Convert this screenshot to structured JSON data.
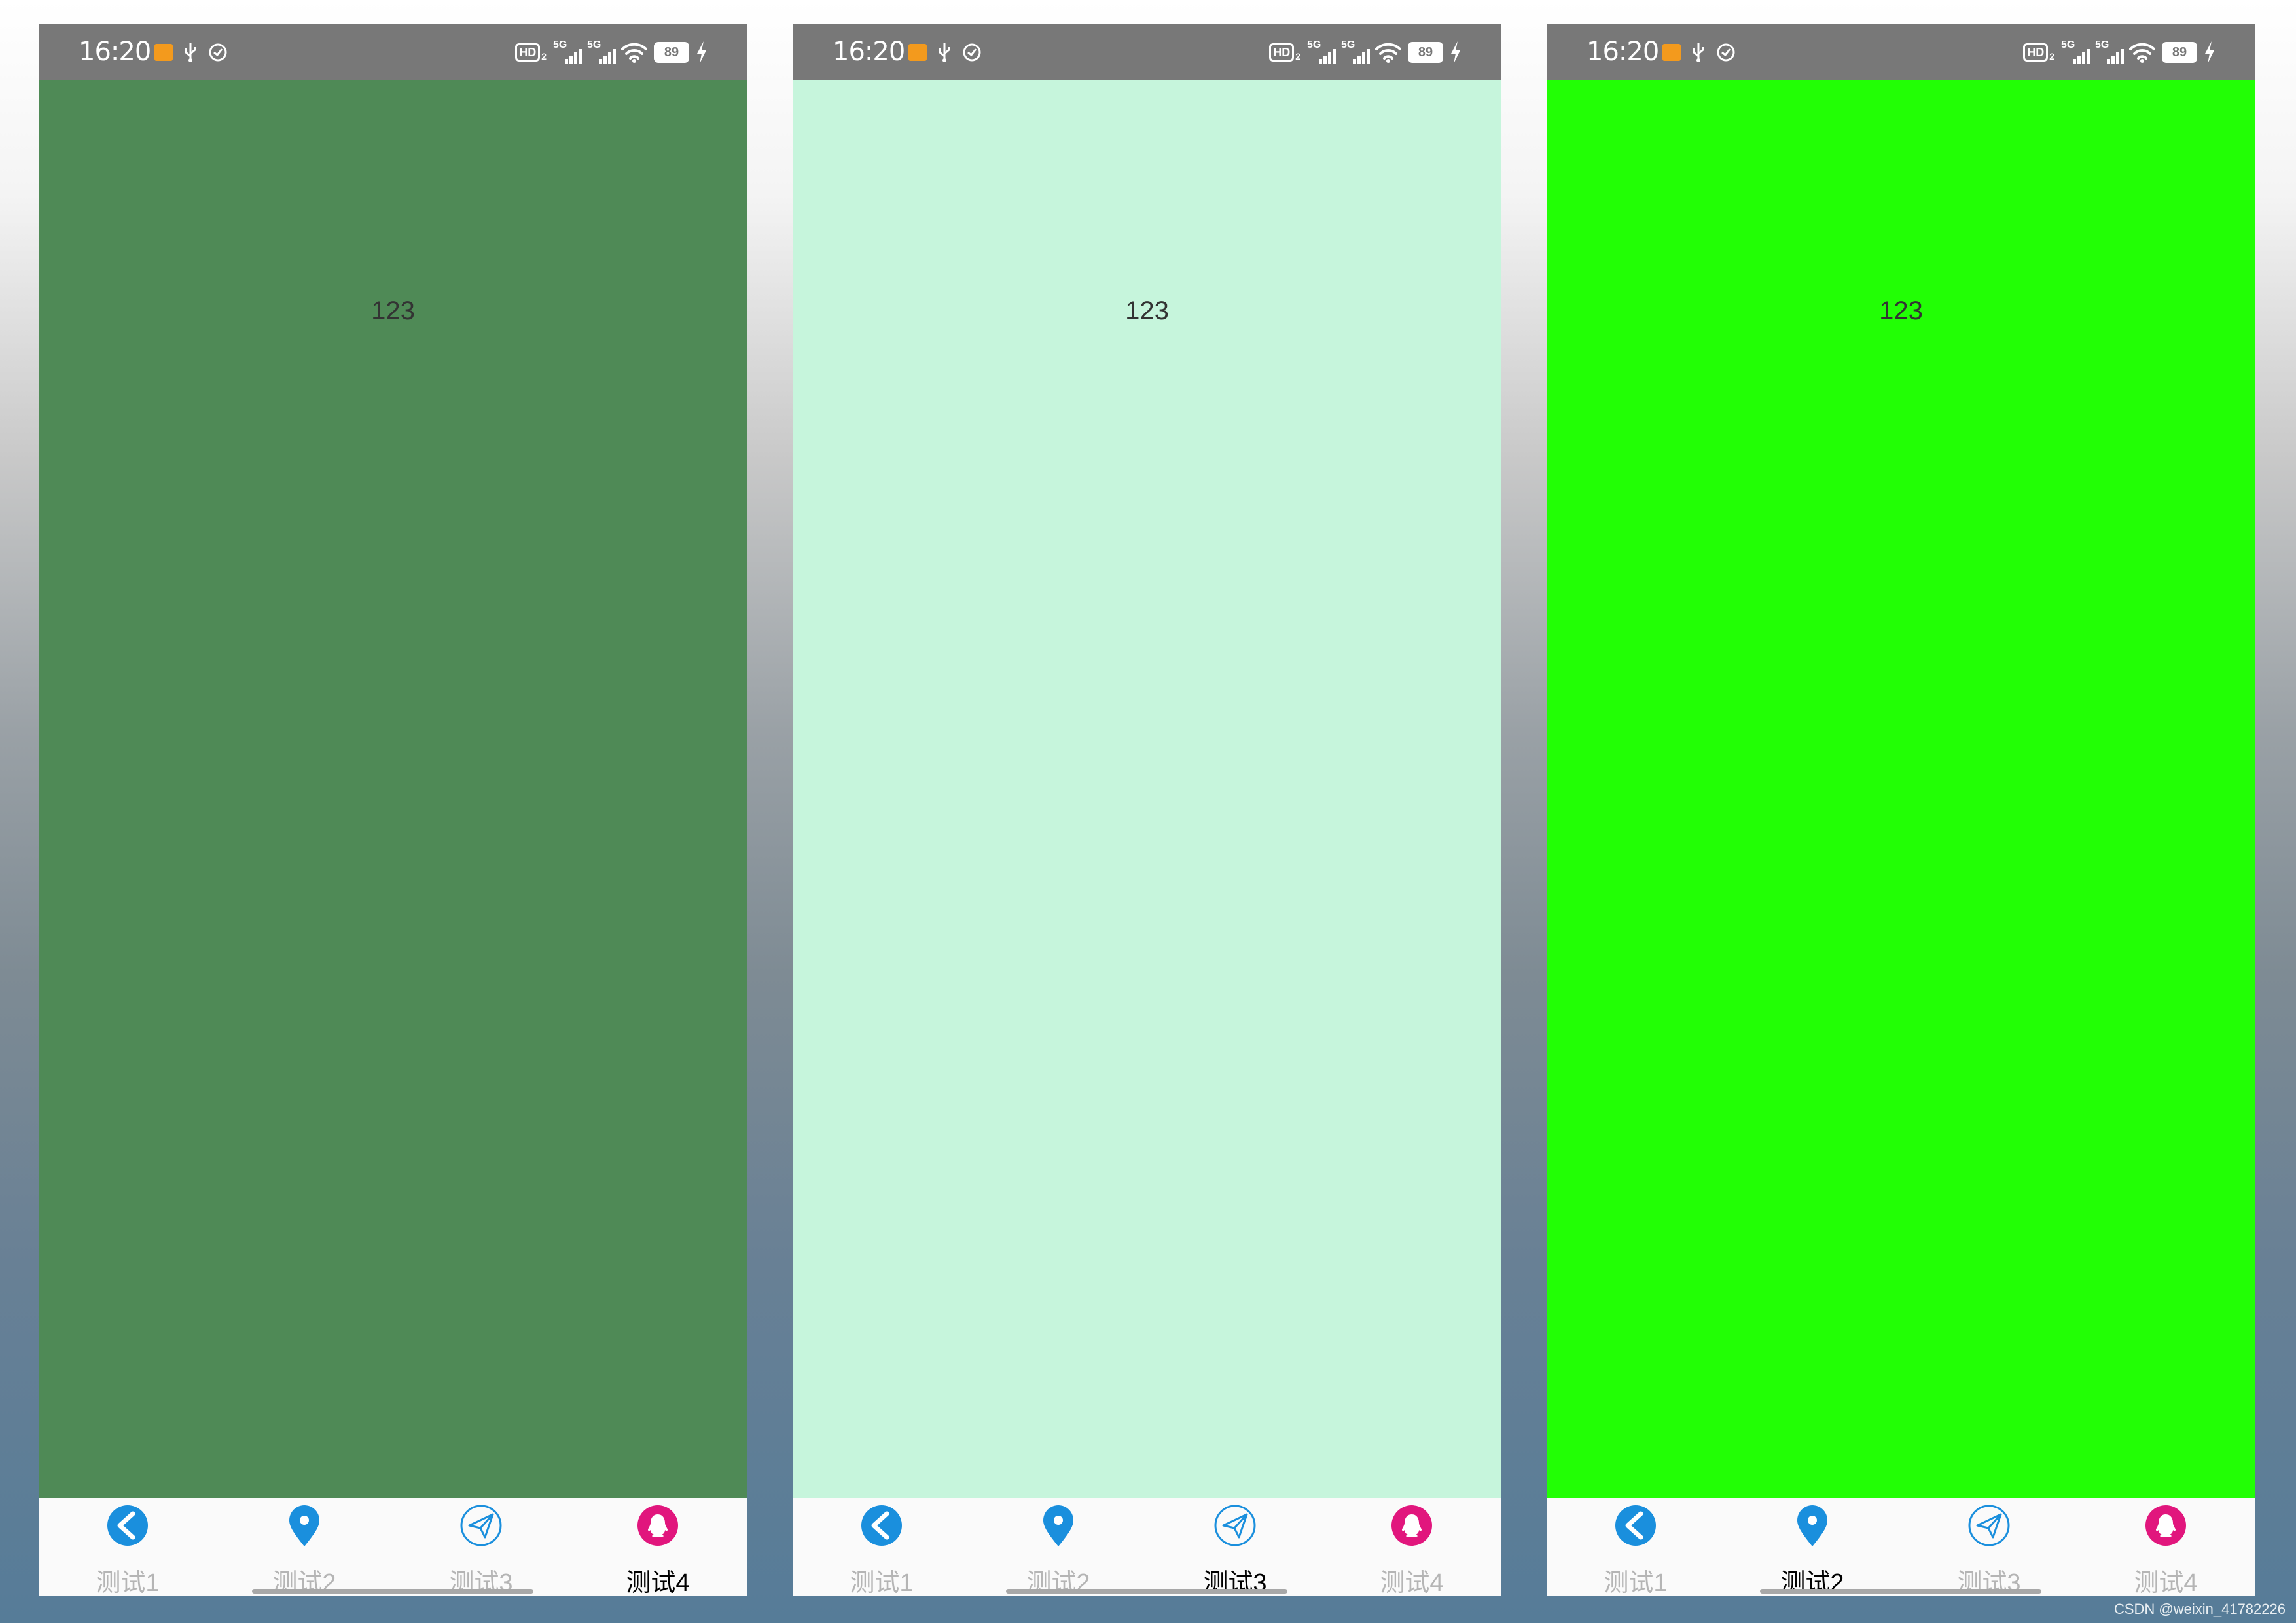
{
  "colors": {
    "status_bar": "#787878",
    "tab_icon_blue": "#1a8fdd",
    "tab_icon_pink": "#e1167d",
    "tab_inactive": "#b5b5b5",
    "tab_active": "#000000"
  },
  "screens": [
    {
      "status": {
        "time": "16:20",
        "battery": "89"
      },
      "content_text": "123",
      "content_color": "#4f8a56",
      "tabs": [
        {
          "label": "测试1",
          "icon": "back-circle-icon",
          "active": false
        },
        {
          "label": "测试2",
          "icon": "location-pin-icon",
          "active": false
        },
        {
          "label": "测试3",
          "icon": "paper-plane-icon",
          "active": false
        },
        {
          "label": "测试4",
          "icon": "qq-penguin-icon",
          "active": true
        }
      ]
    },
    {
      "status": {
        "time": "16:20",
        "battery": "89"
      },
      "content_text": "123",
      "content_color": "#c6f5dc",
      "tabs": [
        {
          "label": "测试1",
          "icon": "back-circle-icon",
          "active": false
        },
        {
          "label": "测试2",
          "icon": "location-pin-icon",
          "active": false
        },
        {
          "label": "测试3",
          "icon": "paper-plane-icon",
          "active": true
        },
        {
          "label": "测试4",
          "icon": "qq-penguin-icon",
          "active": false
        }
      ]
    },
    {
      "status": {
        "time": "16:20",
        "battery": "89"
      },
      "content_text": "123",
      "content_color": "#22ff05",
      "tabs": [
        {
          "label": "测试1",
          "icon": "back-circle-icon",
          "active": false
        },
        {
          "label": "测试2",
          "icon": "location-pin-icon",
          "active": true
        },
        {
          "label": "测试3",
          "icon": "paper-plane-icon",
          "active": false
        },
        {
          "label": "测试4",
          "icon": "qq-penguin-icon",
          "active": false
        }
      ]
    }
  ],
  "watermark": "CSDN @weixin_41782226"
}
